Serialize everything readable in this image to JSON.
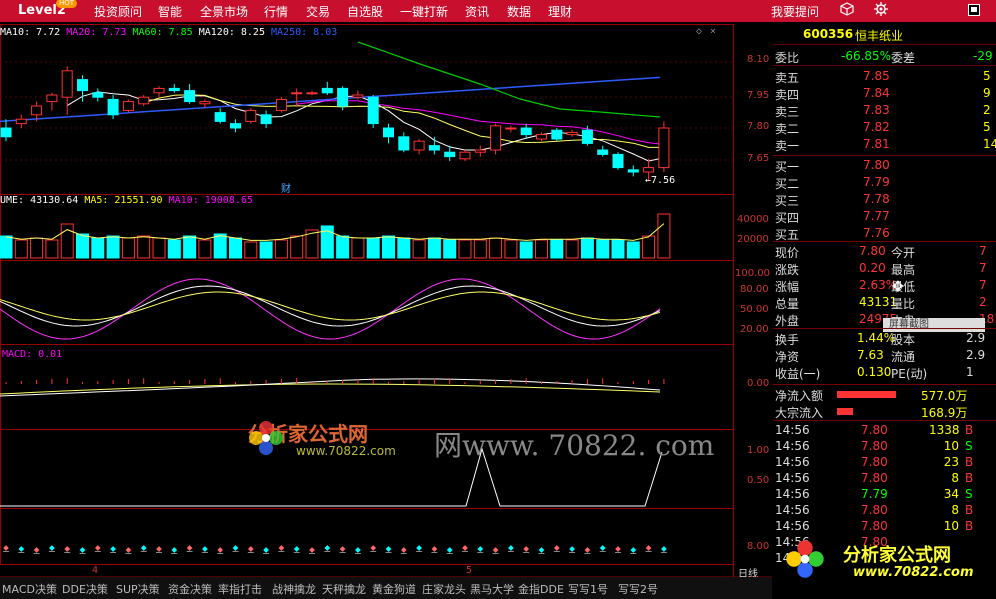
{
  "topbar": {
    "brand": "Level2",
    "hot_badge": "HOT",
    "menu": [
      "投资顾问",
      "智能",
      "全景市场",
      "行情",
      "交易",
      "自选股",
      "一键打新",
      "资讯",
      "数据",
      "理财"
    ],
    "right_link": "我要提问"
  },
  "main_chart": {
    "ma_legend": [
      {
        "label": "MA10: 7.72",
        "color": "#ffffff"
      },
      {
        "label": "MA20: 7.73",
        "color": "#ff00ff"
      },
      {
        "label": "MA60: 7.85",
        "color": "#00ff00"
      },
      {
        "label": "MA120: 8.25",
        "color": "#ffffff"
      },
      {
        "label": "MA250: 8.03",
        "color": "#2f5bff"
      }
    ],
    "price_ticks": [
      "8.10",
      "7.95",
      "7.80",
      "7.65"
    ],
    "last_price_label": "←7.56",
    "cai_label": "财"
  },
  "volume_panel": {
    "legend": [
      {
        "label": "UME: 43130.64",
        "color": "#ffffff"
      },
      {
        "label": "MA5: 21551.90",
        "color": "#ffff00"
      },
      {
        "label": "MA10: 19008.65",
        "color": "#ff00ff"
      }
    ],
    "ticks": [
      "40000",
      "20000"
    ]
  },
  "kdj_panel": {
    "ticks": [
      "100.00",
      "80.00",
      "50.00",
      "20.00"
    ]
  },
  "macd_panel": {
    "legend": "MACD: 0.01",
    "ticks": [
      "0.00"
    ]
  },
  "signal_panel": {
    "ticks": [
      "1.00",
      "0.50"
    ]
  },
  "bottom_panel": {
    "ticks": [
      "8.00"
    ]
  },
  "bottom_axis": {
    "labels": [
      "4",
      "5"
    ],
    "period": "日线"
  },
  "tabs": [
    "MACD决策",
    "DDE决策",
    "SUP决策",
    "资金决策",
    "率指打击",
    "战神擒龙",
    "天秤擒龙",
    "黄金狗道",
    "庄家龙头",
    "黑马大学",
    "金指DDE",
    "写写1号",
    "写写2号"
  ],
  "watermark": {
    "brand": "分析家公式网",
    "site_a": "www.70822.com",
    "site_b": "网www. 70822. com",
    "brand2": "分析家公式网",
    "site_c": "www.70822.com"
  },
  "quote": {
    "code": "600356",
    "name": "恒丰纸业",
    "weibi_label": "委比",
    "weibi_value": "-66.85%",
    "weicha_label": "委差",
    "weicha_value": "-29",
    "asks": [
      {
        "label": "卖五",
        "price": "7.85",
        "vol": "5"
      },
      {
        "label": "卖四",
        "price": "7.84",
        "vol": "9"
      },
      {
        "label": "卖三",
        "price": "7.83",
        "vol": "2"
      },
      {
        "label": "卖二",
        "price": "7.82",
        "vol": "5"
      },
      {
        "label": "卖一",
        "price": "7.81",
        "vol": "14"
      }
    ],
    "bids": [
      {
        "label": "买一",
        "price": "7.80",
        "vol": ""
      },
      {
        "label": "买二",
        "price": "7.79",
        "vol": ""
      },
      {
        "label": "买三",
        "price": "7.78",
        "vol": ""
      },
      {
        "label": "买四",
        "price": "7.77",
        "vol": ""
      },
      {
        "label": "买五",
        "price": "7.76",
        "vol": ""
      }
    ],
    "stats": [
      {
        "l1": "现价",
        "v1": "7.80",
        "c1": "#ff3333",
        "l2": "今开",
        "v2": "7"
      },
      {
        "l1": "涨跌",
        "v1": "0.20",
        "c1": "#ff3333",
        "l2": "最高",
        "v2": "7"
      },
      {
        "l1": "涨幅",
        "v1": "2.63%",
        "c1": "#ff3333",
        "l2": "最低",
        "v2": "7"
      },
      {
        "l1": "总量",
        "v1": "43131",
        "c1": "#ffff00",
        "l2": "量比",
        "v2": "2"
      },
      {
        "l1": "外盘",
        "v1": "24975",
        "c1": "#ff3333",
        "l2": "内盘",
        "v2": "181"
      }
    ],
    "tooltip": "屏幕截图",
    "fund": [
      {
        "l1": "换手",
        "v1": "1.44%",
        "l2": "股本",
        "v2": "2.9"
      },
      {
        "l1": "净资",
        "v1": "7.63",
        "l2": "流通",
        "v2": "2.9"
      },
      {
        "l1": "收益(一)",
        "v1": "0.130",
        "l2": "PE(动)",
        "v2": "1"
      }
    ],
    "flows": [
      {
        "label": "净流入额",
        "value": "577.0万",
        "bar": 0.9
      },
      {
        "label": "大宗流入",
        "value": "168.9万",
        "bar": 0.25
      }
    ],
    "ticks": [
      {
        "time": "14:56",
        "price": "7.80",
        "vol": "1338",
        "side": "B"
      },
      {
        "time": "14:56",
        "price": "7.80",
        "vol": "10",
        "side": "S"
      },
      {
        "time": "14:56",
        "price": "7.80",
        "vol": "23",
        "side": "B"
      },
      {
        "time": "14:56",
        "price": "7.80",
        "vol": "8",
        "side": "B"
      },
      {
        "time": "14:56",
        "price": "7.79",
        "vol": "34",
        "side": "S"
      },
      {
        "time": "14:56",
        "price": "7.80",
        "vol": "8",
        "side": "B"
      },
      {
        "time": "14:56",
        "price": "7.80",
        "vol": "10",
        "side": "B"
      },
      {
        "time": "14:56",
        "price": "7.80",
        "vol": "",
        "side": ""
      },
      {
        "time": "14:5",
        "price": "",
        "vol": "",
        "side": ""
      }
    ],
    "colors": {
      "red": "#ff3333",
      "green": "#00ff00",
      "yellow": "#ffff00",
      "cyan": "#00ffff",
      "white": "#ffffff"
    }
  },
  "candles": [
    {
      "o": 7.8,
      "h": 7.84,
      "l": 7.74,
      "c": 7.76
    },
    {
      "o": 7.82,
      "h": 7.86,
      "l": 7.8,
      "c": 7.84
    },
    {
      "o": 7.86,
      "h": 7.92,
      "l": 7.83,
      "c": 7.9
    },
    {
      "o": 7.92,
      "h": 7.96,
      "l": 7.88,
      "c": 7.95
    },
    {
      "o": 7.94,
      "h": 8.08,
      "l": 7.86,
      "c": 8.06
    },
    {
      "o": 8.02,
      "h": 8.04,
      "l": 7.92,
      "c": 7.97
    },
    {
      "o": 7.96,
      "h": 7.98,
      "l": 7.92,
      "c": 7.94
    },
    {
      "o": 7.93,
      "h": 7.95,
      "l": 7.84,
      "c": 7.86
    },
    {
      "o": 7.88,
      "h": 7.93,
      "l": 7.87,
      "c": 7.92
    },
    {
      "o": 7.91,
      "h": 7.95,
      "l": 7.9,
      "c": 7.94
    },
    {
      "o": 7.96,
      "h": 7.99,
      "l": 7.94,
      "c": 7.98
    },
    {
      "o": 7.98,
      "h": 8.0,
      "l": 7.96,
      "c": 7.97
    },
    {
      "o": 7.97,
      "h": 8.0,
      "l": 7.91,
      "c": 7.92
    },
    {
      "o": 7.91,
      "h": 7.93,
      "l": 7.89,
      "c": 7.92
    },
    {
      "o": 7.87,
      "h": 7.89,
      "l": 7.82,
      "c": 7.83
    },
    {
      "o": 7.82,
      "h": 7.84,
      "l": 7.78,
      "c": 7.8
    },
    {
      "o": 7.83,
      "h": 7.89,
      "l": 7.82,
      "c": 7.88
    },
    {
      "o": 7.86,
      "h": 7.88,
      "l": 7.8,
      "c": 7.82
    },
    {
      "o": 7.88,
      "h": 7.94,
      "l": 7.87,
      "c": 7.93
    },
    {
      "o": 7.96,
      "h": 7.98,
      "l": 7.9,
      "c": 7.96
    },
    {
      "o": 7.96,
      "h": 7.97,
      "l": 7.95,
      "c": 7.96
    },
    {
      "o": 7.98,
      "h": 8.01,
      "l": 7.95,
      "c": 7.96
    },
    {
      "o": 7.98,
      "h": 7.99,
      "l": 7.88,
      "c": 7.9
    },
    {
      "o": 7.94,
      "h": 7.97,
      "l": 7.93,
      "c": 7.95
    },
    {
      "o": 7.94,
      "h": 7.95,
      "l": 7.8,
      "c": 7.82
    },
    {
      "o": 7.8,
      "h": 7.82,
      "l": 7.73,
      "c": 7.76
    },
    {
      "o": 7.76,
      "h": 7.78,
      "l": 7.69,
      "c": 7.7
    },
    {
      "o": 7.7,
      "h": 7.75,
      "l": 7.68,
      "c": 7.74
    },
    {
      "o": 7.72,
      "h": 7.76,
      "l": 7.68,
      "c": 7.7
    },
    {
      "o": 7.69,
      "h": 7.72,
      "l": 7.65,
      "c": 7.67
    },
    {
      "o": 7.66,
      "h": 7.7,
      "l": 7.65,
      "c": 7.69
    },
    {
      "o": 7.69,
      "h": 7.72,
      "l": 7.67,
      "c": 7.7
    },
    {
      "o": 7.7,
      "h": 7.82,
      "l": 7.68,
      "c": 7.81
    },
    {
      "o": 7.8,
      "h": 7.81,
      "l": 7.78,
      "c": 7.8
    },
    {
      "o": 7.8,
      "h": 7.82,
      "l": 7.75,
      "c": 7.77
    },
    {
      "o": 7.75,
      "h": 7.78,
      "l": 7.74,
      "c": 7.77
    },
    {
      "o": 7.79,
      "h": 7.8,
      "l": 7.74,
      "c": 7.75
    },
    {
      "o": 7.77,
      "h": 7.79,
      "l": 7.76,
      "c": 7.78
    },
    {
      "o": 7.79,
      "h": 7.81,
      "l": 7.72,
      "c": 7.73
    },
    {
      "o": 7.7,
      "h": 7.72,
      "l": 7.67,
      "c": 7.68
    },
    {
      "o": 7.68,
      "h": 7.69,
      "l": 7.61,
      "c": 7.62
    },
    {
      "o": 7.61,
      "h": 7.63,
      "l": 7.58,
      "c": 7.6
    },
    {
      "o": 7.6,
      "h": 7.66,
      "l": 7.56,
      "c": 7.62
    },
    {
      "o": 7.62,
      "h": 7.83,
      "l": 7.6,
      "c": 7.8
    }
  ],
  "volumes": [
    0.55,
    0.45,
    0.5,
    0.45,
    0.85,
    0.6,
    0.5,
    0.55,
    0.5,
    0.55,
    0.5,
    0.45,
    0.55,
    0.45,
    0.6,
    0.5,
    0.4,
    0.4,
    0.45,
    0.55,
    0.7,
    0.8,
    0.55,
    0.5,
    0.5,
    0.55,
    0.5,
    0.45,
    0.5,
    0.45,
    0.45,
    0.45,
    0.5,
    0.45,
    0.4,
    0.45,
    0.45,
    0.45,
    0.5,
    0.45,
    0.45,
    0.4,
    0.55,
    1.1
  ]
}
